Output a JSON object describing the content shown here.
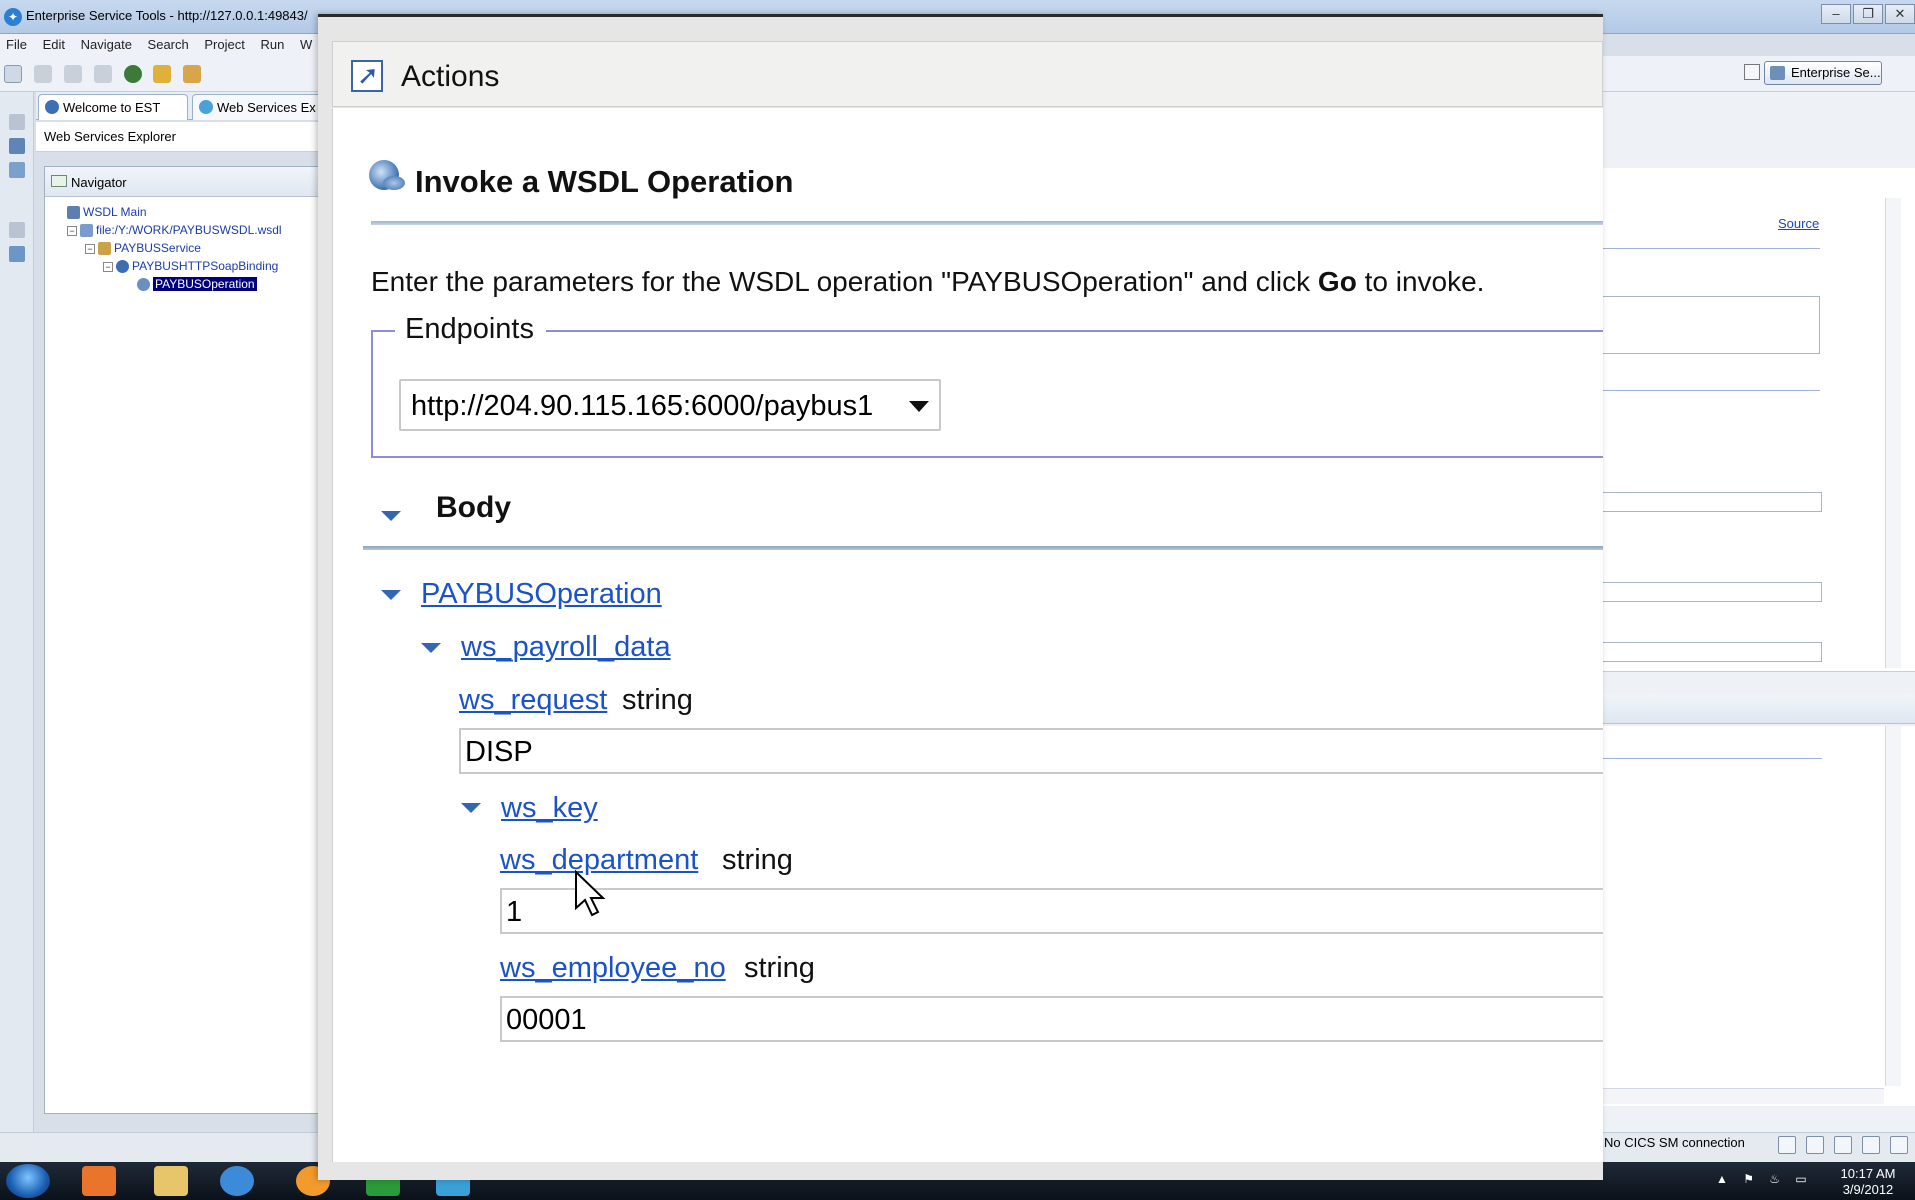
{
  "window": {
    "title": "Enterprise Service Tools - http://127.0.0.1:49843/",
    "controls": [
      "–",
      "❐",
      "✕"
    ]
  },
  "menu": [
    "File",
    "Edit",
    "Navigate",
    "Search",
    "Project",
    "Run",
    "W"
  ],
  "perspective": {
    "label": "Enterprise Se..."
  },
  "tabs": [
    {
      "label": "Welcome to EST",
      "icon": "welcome-icon"
    },
    {
      "label": "Web Services Ex",
      "icon": "globe-icon"
    }
  ],
  "explorer": {
    "label": "Web Services Explorer"
  },
  "navigator": {
    "title": "Navigator",
    "items": [
      {
        "label": "WSDL Main",
        "icon": "wsdl-main-icon"
      },
      {
        "label": "file:/Y:/WORK/PAYBUSWSDL.wsdl",
        "icon": "wsdl-file-icon"
      },
      {
        "label": "PAYBUSService",
        "icon": "service-icon"
      },
      {
        "label": "PAYBUSHTTPSoapBinding",
        "icon": "binding-icon"
      },
      {
        "label": "PAYBUSOperation",
        "icon": "operation-icon",
        "selected": true
      }
    ]
  },
  "right_panel": {
    "source_link": "Source"
  },
  "actions": {
    "title": "Actions",
    "invoke_title": "Invoke a WSDL Operation",
    "instructions_pre": "Enter the parameters for the WSDL operation \"PAYBUSOperation\" and click ",
    "instructions_go": "Go",
    "instructions_post": " to invoke.",
    "endpoints_label": "Endpoints",
    "endpoint_value": "http://204.90.115.165:6000/paybus1",
    "body_label": "Body",
    "operation_link": "PAYBUSOperation",
    "payroll_link": "ws_payroll_data",
    "request_link": "ws_request",
    "request_type": "string",
    "request_value": "DISP",
    "key_link": "ws_key",
    "department_link": "ws_department",
    "department_type": "string",
    "department_value": "1",
    "employee_link": "ws_employee_no",
    "employee_type": "string",
    "employee_value": "00001"
  },
  "status": {
    "cics": "No CICS SM connection"
  },
  "clock": {
    "time": "10:17 AM",
    "date": "3/9/2012"
  },
  "colors": {
    "link": "#1a53c8",
    "fieldset_border": "#8d8de0",
    "selection": "#000080"
  }
}
